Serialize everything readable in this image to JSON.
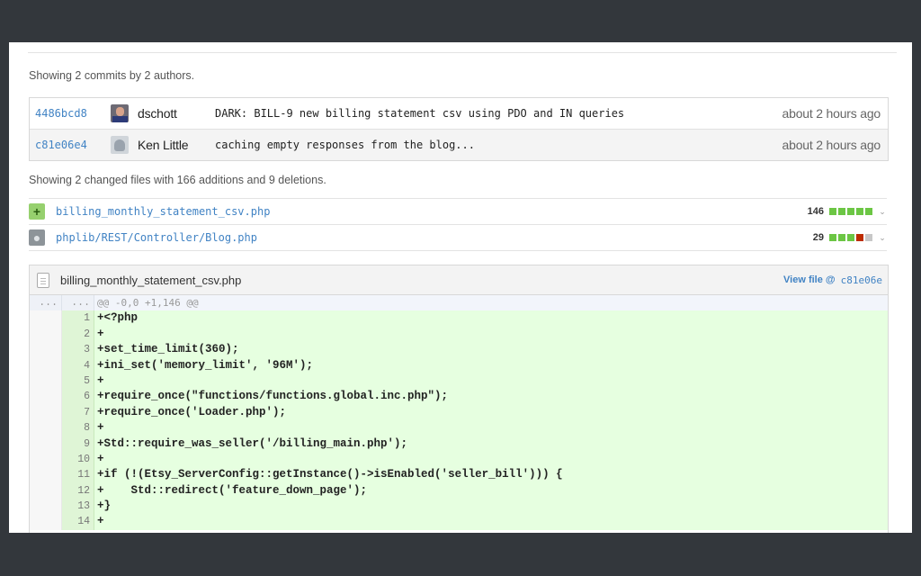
{
  "summary": {
    "commits_text": "Showing 2 commits by 2 authors.",
    "files_text": "Showing 2 changed files with 166 additions and 9 deletions."
  },
  "commits": [
    {
      "sha": "4486bcd8",
      "author": "dschott",
      "avatar": "user-photo-avatar",
      "message": "DARK: BILL-9 new billing statement csv using PDO and IN queries",
      "time": "about 2 hours ago"
    },
    {
      "sha": "c81e06e4",
      "author": "Ken Little",
      "avatar": "octocat-avatar",
      "message": "caching empty responses from the blog...",
      "time": "about 2 hours ago"
    }
  ],
  "files": [
    {
      "icon": "added-file-icon",
      "symbol": "+",
      "name": "billing_monthly_statement_csv.php",
      "count": "146",
      "blocks": [
        "#6cc644",
        "#6cc644",
        "#6cc644",
        "#6cc644",
        "#6cc644"
      ]
    },
    {
      "icon": "modified-file-icon",
      "symbol": "●",
      "name": "phplib/REST/Controller/Blog.php",
      "count": "29",
      "blocks": [
        "#6cc644",
        "#6cc644",
        "#6cc644",
        "#bd2c00",
        "#c8c8c8"
      ]
    }
  ],
  "diff": {
    "filename": "billing_monthly_statement_csv.php",
    "view_file_label": "View file @",
    "view_file_sha": "c81e06e",
    "hunk": {
      "old": "...",
      "new": "...",
      "text": "@@ -0,0 +1,146 @@"
    },
    "lines": [
      {
        "n": "1",
        "code": "+<?php"
      },
      {
        "n": "2",
        "code": "+"
      },
      {
        "n": "3",
        "code": "+set_time_limit(360);"
      },
      {
        "n": "4",
        "code": "+ini_set('memory_limit', '96M');"
      },
      {
        "n": "5",
        "code": "+"
      },
      {
        "n": "6",
        "code": "+require_once(\"functions/functions.global.inc.php\");"
      },
      {
        "n": "7",
        "code": "+require_once('Loader.php');"
      },
      {
        "n": "8",
        "code": "+"
      },
      {
        "n": "9",
        "code": "+Std::require_was_seller('/billing_main.php');"
      },
      {
        "n": "10",
        "code": "+"
      },
      {
        "n": "11",
        "code": "+if (!(Etsy_ServerConfig::getInstance()->isEnabled('seller_bill'))) {"
      },
      {
        "n": "12",
        "code": "+    Std::redirect('feature_down_page');"
      },
      {
        "n": "13",
        "code": "+}"
      },
      {
        "n": "14",
        "code": "+"
      }
    ]
  }
}
